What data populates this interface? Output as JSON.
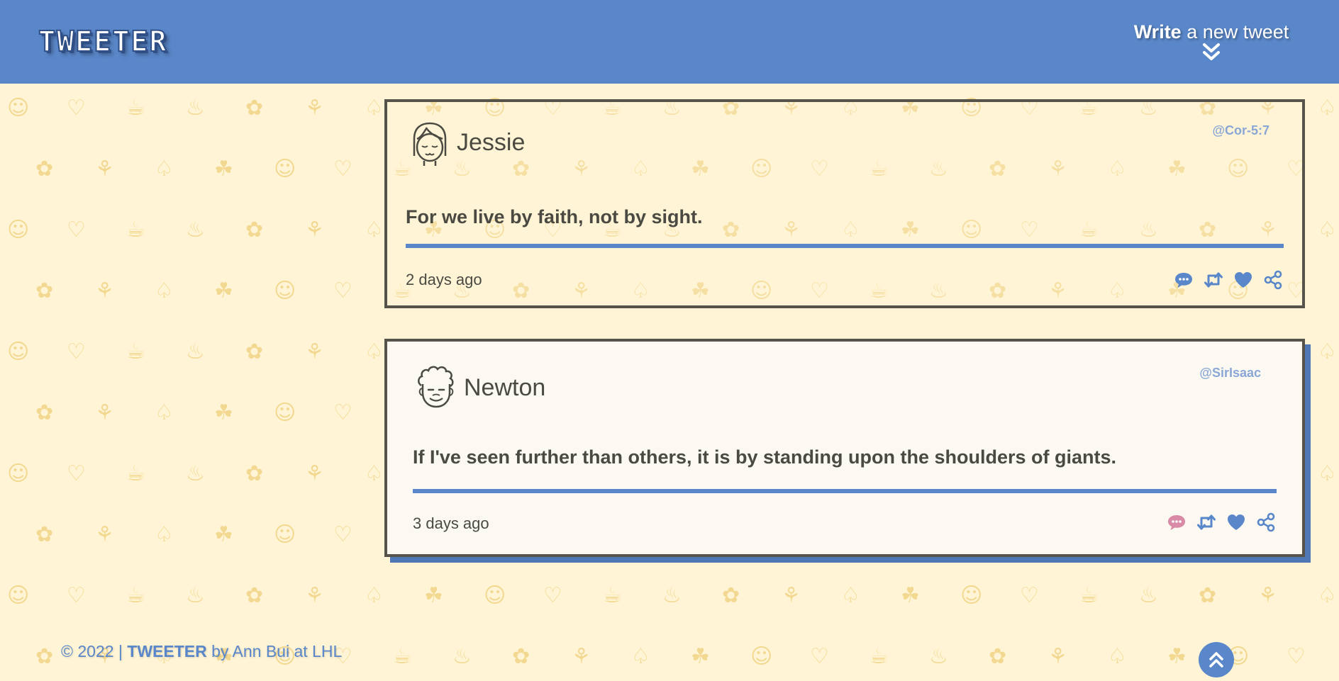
{
  "header": {
    "logo": "TWEETER",
    "compose_bold": "Write",
    "compose_rest": "a new tweet",
    "compose_icon": "double-chevron-down-icon"
  },
  "tweets": [
    {
      "name": "Jessie",
      "handle": "@Cor-5:7",
      "text": "For we live by faith, not by sight.",
      "time": "2 days ago",
      "avatar_icon": "girl-avatar-icon"
    },
    {
      "name": "Newton",
      "handle": "@SirIsaac",
      "text": "If I've seen further than others, it is by standing upon the shoulders of giants.",
      "time": "3 days ago",
      "avatar_icon": "curly-hair-avatar-icon"
    }
  ],
  "actions": [
    "comment-icon",
    "retweet-icon",
    "heart-icon",
    "share-icon"
  ],
  "footer": {
    "prefix": "© 2022 | ",
    "brand": "TWEETER",
    "suffix": " by Ann Bui at LHL"
  },
  "colors": {
    "primary": "#5a87c9",
    "background": "#fff5d6",
    "text": "#4b4a42",
    "handle": "#8aa6d6",
    "comment_hover": "#d88aa7"
  }
}
